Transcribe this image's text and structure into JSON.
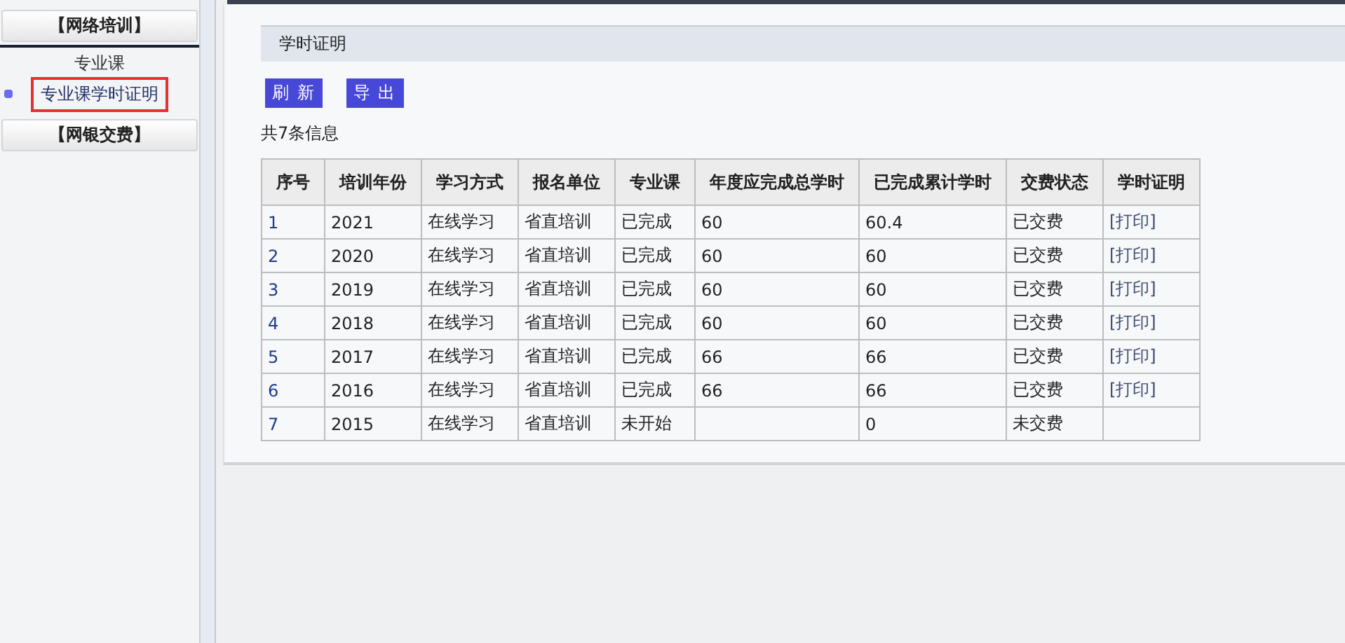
{
  "sidebar": {
    "sections": [
      {
        "title": "【网络培训】",
        "items": [
          {
            "label": "专业课",
            "selected": false
          },
          {
            "label": "专业课学时证明",
            "selected": true
          }
        ]
      },
      {
        "title": "【网银交费】"
      }
    ]
  },
  "panel": {
    "title": "学时证明",
    "buttons": [
      "刷 新",
      "导 出"
    ],
    "summary": "共7条信息"
  },
  "table": {
    "columns": [
      {
        "label": "序号",
        "kind": "index"
      },
      {
        "label": "培训年份",
        "kind": "text"
      },
      {
        "label": "学习方式",
        "kind": "text"
      },
      {
        "label": "报名单位",
        "kind": "text"
      },
      {
        "label": "专业课",
        "kind": "text"
      },
      {
        "label": "年度应完成总学时",
        "kind": "text"
      },
      {
        "label": "已完成累计学时",
        "kind": "text"
      },
      {
        "label": "交费状态",
        "kind": "text"
      },
      {
        "label": "学时证明",
        "kind": "link"
      }
    ],
    "rows": [
      [
        "1",
        "2021",
        "在线学习",
        "省直培训",
        "已完成",
        "60",
        "60.4",
        "已交费",
        "[打印]"
      ],
      [
        "2",
        "2020",
        "在线学习",
        "省直培训",
        "已完成",
        "60",
        "60",
        "已交费",
        "[打印]"
      ],
      [
        "3",
        "2019",
        "在线学习",
        "省直培训",
        "已完成",
        "60",
        "60",
        "已交费",
        "[打印]"
      ],
      [
        "4",
        "2018",
        "在线学习",
        "省直培训",
        "已完成",
        "60",
        "60",
        "已交费",
        "[打印]"
      ],
      [
        "5",
        "2017",
        "在线学习",
        "省直培训",
        "已完成",
        "66",
        "66",
        "已交费",
        "[打印]"
      ],
      [
        "6",
        "2016",
        "在线学习",
        "省直培训",
        "已完成",
        "66",
        "66",
        "已交费",
        "[打印]"
      ],
      [
        "7",
        "2015",
        "在线学习",
        "省直培训",
        "未开始",
        "",
        "0",
        "未交费",
        ""
      ]
    ]
  }
}
